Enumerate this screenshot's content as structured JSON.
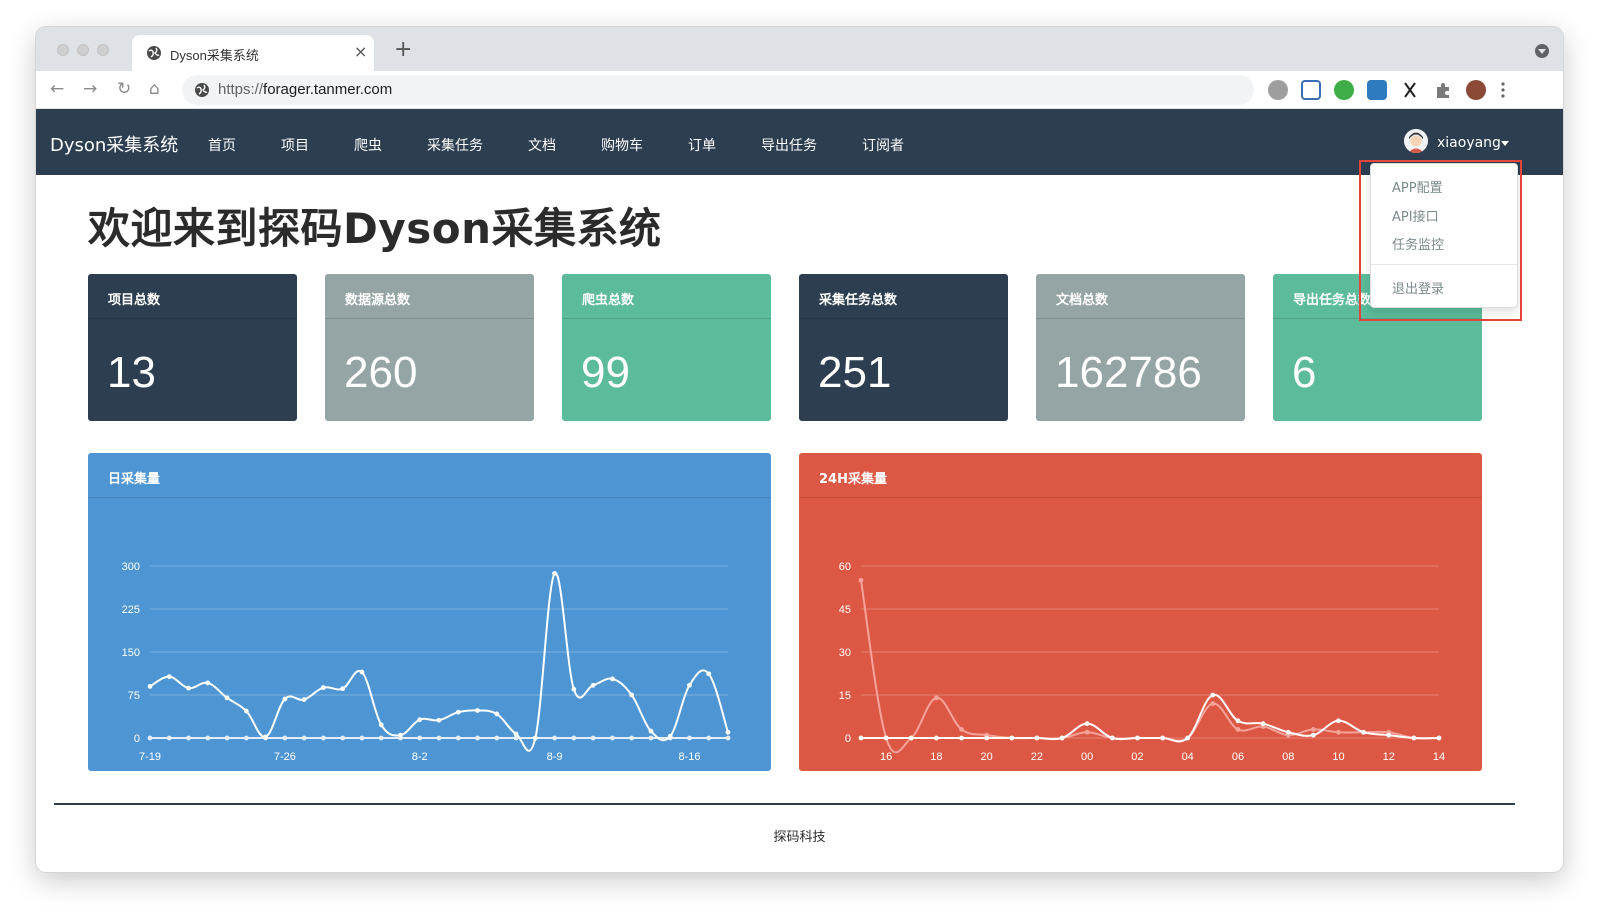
{
  "browser": {
    "tab_title": "Dyson采集系统",
    "tab_close": "×",
    "new_tab": "+",
    "url_scheme": "https://",
    "url_host": "forager.tanmer.com",
    "back": "←",
    "forward": "→",
    "reload": "↻",
    "home": "⌂"
  },
  "navbar": {
    "brand": "Dyson采集系统",
    "links": [
      "首页",
      "项目",
      "爬虫",
      "采集任务",
      "文档",
      "购物车",
      "订单",
      "导出任务",
      "订阅者"
    ],
    "user": "xiaoyang"
  },
  "dropdown": {
    "items": [
      "APP配置",
      "API接口",
      "任务监控"
    ],
    "logout": "退出登录"
  },
  "heading": "欢迎来到探码Dyson采集系统",
  "stats": [
    {
      "label": "项目总数",
      "value": "13",
      "color": "#2c3e50"
    },
    {
      "label": "数据源总数",
      "value": "260",
      "color": "#95a5a6"
    },
    {
      "label": "爬虫总数",
      "value": "99",
      "color": "#5bbb9b"
    },
    {
      "label": "采集任务总数",
      "value": "251",
      "color": "#2c3e50"
    },
    {
      "label": "文档总数",
      "value": "162786",
      "color": "#95a5a6"
    },
    {
      "label": "导出任务总数",
      "value": "6",
      "color": "#5bbb9b"
    }
  ],
  "chart_data": [
    {
      "type": "line",
      "title": "日采集量",
      "background": "#4e95d3",
      "ylim": [
        0,
        300
      ],
      "yticks": [
        0,
        75,
        150,
        225,
        300
      ],
      "xtick_labels": [
        "7-19",
        "7-26",
        "8-2",
        "8-9",
        "8-16"
      ],
      "xtick_index": [
        0,
        7,
        14,
        21,
        28
      ],
      "grid": true,
      "series": [
        {
          "color": "#ffffff",
          "values": [
            90,
            107,
            87,
            96,
            70,
            47,
            2,
            68,
            67,
            88,
            86,
            115,
            23,
            5,
            32,
            31,
            45,
            48,
            42,
            7,
            0,
            287,
            85,
            92,
            103,
            75,
            12,
            3,
            92,
            112,
            10
          ]
        },
        {
          "color": "#e3eef9",
          "values": [
            0,
            0,
            0,
            0,
            0,
            0,
            0,
            0,
            0,
            0,
            0,
            0,
            0,
            0,
            0,
            0,
            0,
            0,
            0,
            0,
            0,
            0,
            0,
            0,
            0,
            0,
            0,
            0,
            0,
            0,
            0
          ]
        }
      ]
    },
    {
      "type": "line",
      "title": "24H采集量",
      "background": "#dc5744",
      "ylim": [
        0,
        60
      ],
      "yticks": [
        0,
        15,
        30,
        45,
        60
      ],
      "xtick_labels": [
        "16",
        "18",
        "20",
        "22",
        "00",
        "02",
        "04",
        "06",
        "08",
        "10",
        "12",
        "14"
      ],
      "xtick_index": [
        1,
        3,
        5,
        7,
        9,
        11,
        13,
        15,
        17,
        19,
        21,
        23
      ],
      "grid": true,
      "series": [
        {
          "color": "#ffffff",
          "values": [
            0,
            0,
            0,
            0,
            0,
            0,
            0,
            0,
            0,
            5,
            0,
            0,
            0,
            0,
            15,
            6,
            5,
            2,
            1,
            6,
            2,
            1,
            0,
            0
          ]
        },
        {
          "color": "#f5a39a",
          "values": [
            55,
            0,
            0,
            14,
            3,
            1,
            0,
            0,
            0,
            2,
            0,
            0,
            0,
            0,
            12,
            3,
            4,
            1,
            3,
            2,
            2,
            2,
            0,
            0
          ]
        }
      ]
    }
  ],
  "footer": "探码科技"
}
